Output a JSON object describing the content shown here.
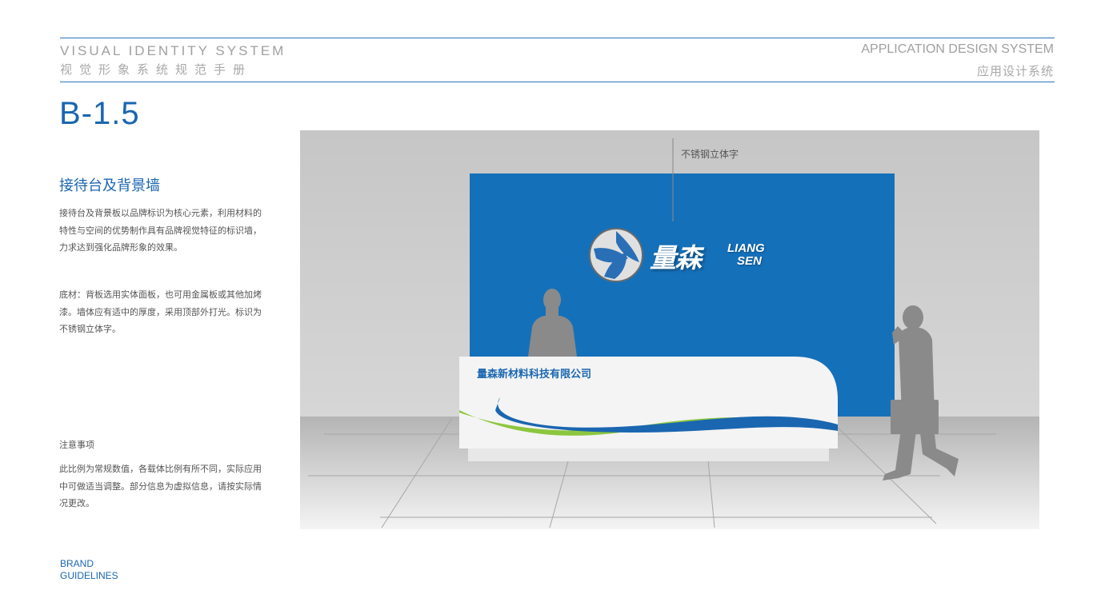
{
  "header": {
    "left_en": "VISUAL  IDENTITY  SYSTEM",
    "left_cn": "视觉形象系统规范手册",
    "right_en": "APPLICATION DESIGN SYSTEM",
    "right_cn": "应用设计系统"
  },
  "page_code": "B-1.5",
  "section": {
    "title": "接待台及背景墙",
    "paragraphs": [
      "接待台及背景板以品牌标识为核心元素，利用材料的特性与空间的优势制作具有品牌视觉特征的标识墙，力求达到强化品牌形象的效果。",
      "底材：背板选用实体面板，也可用金属板或其他加烤漆。墙体应有适中的厚度，采用顶部外打光。标识为不锈钢立体字。"
    ]
  },
  "notes": {
    "title": "注意事项",
    "text": "此比例为常规数值，各载体比例有所不同，实际应用中可做适当调整。部分信息为虚拟信息，请按实际情况更改。"
  },
  "footer": {
    "line1": "BRAND",
    "line2": "GUIDELINES"
  },
  "illustration": {
    "callout": "不锈钢立体字",
    "logo_cn": "量森",
    "logo_en_line1": "LIANG",
    "logo_en_line2": "SEN",
    "desk_company": "量森新材料科技有限公司"
  },
  "colors": {
    "brand_blue": "#1a66b0",
    "wall_blue": "#1570ba",
    "accent_green": "#8cc63f"
  }
}
